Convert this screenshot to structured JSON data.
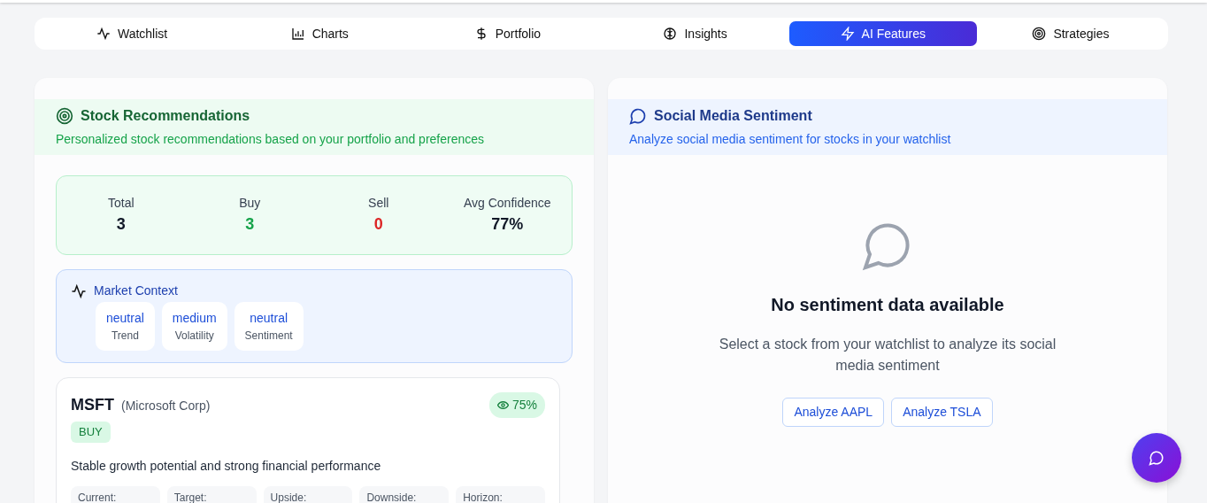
{
  "tabs": [
    {
      "label": "Watchlist",
      "selected": false
    },
    {
      "label": "Charts",
      "selected": false
    },
    {
      "label": "Portfolio",
      "selected": false
    },
    {
      "label": "Insights",
      "selected": false
    },
    {
      "label": "AI Features",
      "selected": true
    },
    {
      "label": "Strategies",
      "selected": false
    }
  ],
  "recommendations": {
    "title": "Stock Recommendations",
    "subtitle": "Personalized stock recommendations based on your portfolio and preferences",
    "stats": [
      {
        "label": "Total",
        "value": "3",
        "color": "#111827"
      },
      {
        "label": "Buy",
        "value": "3",
        "color": "#16a34a"
      },
      {
        "label": "Sell",
        "value": "0",
        "color": "#dc2626"
      },
      {
        "label": "Avg Confidence",
        "value": "77%",
        "color": "#111827"
      }
    ],
    "market_context": {
      "title": "Market Context",
      "items": [
        {
          "value": "neutral",
          "label": "Trend"
        },
        {
          "value": "medium",
          "label": "Volatility"
        },
        {
          "value": "neutral",
          "label": "Sentiment"
        }
      ]
    },
    "stock": {
      "symbol": "MSFT",
      "company": "(Microsoft Corp)",
      "confidence": "75%",
      "action": "BUY",
      "reason": "Stable growth potential and strong financial performance",
      "metrics": [
        "Current:",
        "Target:",
        "Upside:",
        "Downside:",
        "Horizon:"
      ]
    }
  },
  "sentiment": {
    "title": "Social Media Sentiment",
    "subtitle": "Analyze social media sentiment for stocks in your watchlist",
    "empty_title": "No sentiment data available",
    "empty_text": "Select a stock from your watchlist to analyze its social media sentiment",
    "buttons": [
      "Analyze AAPL",
      "Analyze TSLA"
    ]
  }
}
